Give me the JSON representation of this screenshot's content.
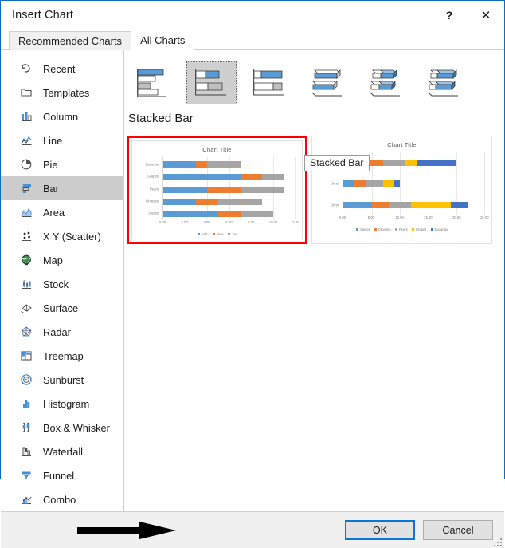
{
  "window": {
    "title": "Insert Chart",
    "help_label": "?",
    "close_label": "✕"
  },
  "tabs": [
    {
      "label": "Recommended Charts",
      "active": false
    },
    {
      "label": "All Charts",
      "active": true
    }
  ],
  "sidebar": {
    "items": [
      {
        "label": "Recent",
        "icon": "recent-icon",
        "selected": false
      },
      {
        "label": "Templates",
        "icon": "templates-icon",
        "selected": false
      },
      {
        "label": "Column",
        "icon": "column-icon",
        "selected": false
      },
      {
        "label": "Line",
        "icon": "line-icon",
        "selected": false
      },
      {
        "label": "Pie",
        "icon": "pie-icon",
        "selected": false
      },
      {
        "label": "Bar",
        "icon": "bar-icon",
        "selected": true
      },
      {
        "label": "Area",
        "icon": "area-icon",
        "selected": false
      },
      {
        "label": "X Y (Scatter)",
        "icon": "scatter-icon",
        "selected": false
      },
      {
        "label": "Map",
        "icon": "map-icon",
        "selected": false
      },
      {
        "label": "Stock",
        "icon": "stock-icon",
        "selected": false
      },
      {
        "label": "Surface",
        "icon": "surface-icon",
        "selected": false
      },
      {
        "label": "Radar",
        "icon": "radar-icon",
        "selected": false
      },
      {
        "label": "Treemap",
        "icon": "treemap-icon",
        "selected": false
      },
      {
        "label": "Sunburst",
        "icon": "sunburst-icon",
        "selected": false
      },
      {
        "label": "Histogram",
        "icon": "histogram-icon",
        "selected": false
      },
      {
        "label": "Box & Whisker",
        "icon": "box-whisker-icon",
        "selected": false
      },
      {
        "label": "Waterfall",
        "icon": "waterfall-icon",
        "selected": false
      },
      {
        "label": "Funnel",
        "icon": "funnel-icon",
        "selected": false
      },
      {
        "label": "Combo",
        "icon": "combo-icon",
        "selected": false
      }
    ]
  },
  "panel": {
    "heading": "Stacked Bar",
    "tooltip": "Stacked Bar",
    "subtypes": [
      {
        "name": "clustered-bar",
        "selected": false
      },
      {
        "name": "stacked-bar",
        "selected": true
      },
      {
        "name": "100-percent-stacked-bar",
        "selected": false
      },
      {
        "name": "3d-clustered-bar",
        "selected": false
      },
      {
        "name": "3d-stacked-bar",
        "selected": false
      },
      {
        "name": "3d-100-percent-stacked-bar",
        "selected": false
      }
    ]
  },
  "colors": {
    "series1": "#5B9BD5",
    "series2": "#ED7D31",
    "series3": "#A5A5A5",
    "series4": "#FFC000",
    "series5": "#4472C4",
    "selection_highlight": "#FF0000",
    "focus_border": "#0A76D4",
    "accent_titlebar": "#0A6EBD"
  },
  "chart_data": [
    {
      "type": "bar",
      "orientation": "horizontal",
      "stacked": true,
      "selected": true,
      "title": "Chart Title",
      "xlabel": "",
      "ylabel": "",
      "categories": [
        "Apples",
        "Oranges",
        "Pears",
        "Grapes",
        "Bananas"
      ],
      "series": [
        {
          "name": "John",
          "color": "#5B9BD5",
          "values": [
            5,
            3,
            4,
            7,
            3
          ]
        },
        {
          "name": "Jane",
          "color": "#ED7D31",
          "values": [
            2,
            2,
            3,
            2,
            1
          ]
        },
        {
          "name": "Joe",
          "color": "#A5A5A5",
          "values": [
            3,
            4,
            4,
            2,
            4
          ]
        }
      ],
      "xlim": [
        0,
        12
      ],
      "xticks": [
        "0.00",
        "2.00",
        "4.00",
        "6.00",
        "8.00",
        "10.00",
        "12.00"
      ],
      "legend_position": "bottom",
      "grid": true
    },
    {
      "type": "bar",
      "orientation": "horizontal",
      "stacked": true,
      "selected": false,
      "title": "Chart Title",
      "xlabel": "",
      "ylabel": "",
      "categories": [
        "John",
        "Jane",
        "Joe"
      ],
      "series": [
        {
          "name": "Apples",
          "color": "#5B9BD5",
          "values": [
            5,
            2,
            3
          ]
        },
        {
          "name": "Oranges",
          "color": "#ED7D31",
          "values": [
            3,
            2,
            4
          ]
        },
        {
          "name": "Pears",
          "color": "#A5A5A5",
          "values": [
            4,
            3,
            4
          ]
        },
        {
          "name": "Grapes",
          "color": "#FFC000",
          "values": [
            7,
            2,
            2
          ]
        },
        {
          "name": "Bananas",
          "color": "#4472C4",
          "values": [
            3,
            1,
            7
          ]
        }
      ],
      "xlim": [
        0,
        25
      ],
      "xticks": [
        "0.00",
        "5.00",
        "10.00",
        "15.00",
        "20.00",
        "25.00"
      ],
      "legend_position": "bottom",
      "grid": true
    }
  ],
  "footer": {
    "ok_label": "OK",
    "cancel_label": "Cancel"
  }
}
